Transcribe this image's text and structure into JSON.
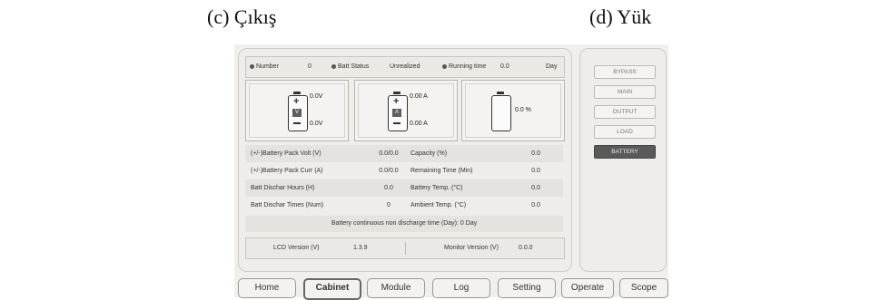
{
  "captions": {
    "c": "(c) Çıkış",
    "d": "(d) Yük"
  },
  "status": {
    "number_label": "Number",
    "number_value": "0",
    "batt_status_label": "Batt Status",
    "batt_status_value": "Unrealized",
    "running_time_label": "Running time",
    "running_time_value": "0.0",
    "running_time_unit": "Day"
  },
  "cards": {
    "voltage": {
      "top": "0.0V",
      "bottom": "0.0V",
      "symbol": "V"
    },
    "current": {
      "top": "0.00 A",
      "bottom": "0.00 A",
      "symbol": "A"
    },
    "capacity": {
      "value": "0.0 %"
    }
  },
  "table": [
    {
      "label": "(+/-)Battery Pack Volt (V)",
      "value": "0.0/0.0",
      "label2": "Capacity (%)",
      "value2": "0.0"
    },
    {
      "label": "(+/-)Battery Pack Curr (A)",
      "value": "0.0/0.0",
      "label2": "Remaining Time (Min)",
      "value2": "0.0"
    },
    {
      "label": "Batt Dischar Hours (H)",
      "value": "0.0",
      "label2": "Battery Temp. (°C)",
      "value2": "0.0"
    },
    {
      "label": "Batt Dischar Times (Num)",
      "value": "0",
      "label2": "Ambient Temp. (°C)",
      "value2": "0.0"
    }
  ],
  "continuous": "Battery continuous non discharge time (Day):   0  Day",
  "version": {
    "lcd_label": "LCD Version (V)",
    "lcd_value": "1.3.9",
    "monitor_label": "Monitor Version (V)",
    "monitor_value": "0.0.0"
  },
  "side_buttons": [
    "BYPASS",
    "MAIN",
    "OUTPUT",
    "LOAD",
    "BATTERY"
  ],
  "nav": [
    "Home",
    "Cabinet",
    "Module",
    "Log",
    "Setting",
    "Operate",
    "Scope"
  ],
  "active_side": "BATTERY",
  "active_nav": "Cabinet"
}
